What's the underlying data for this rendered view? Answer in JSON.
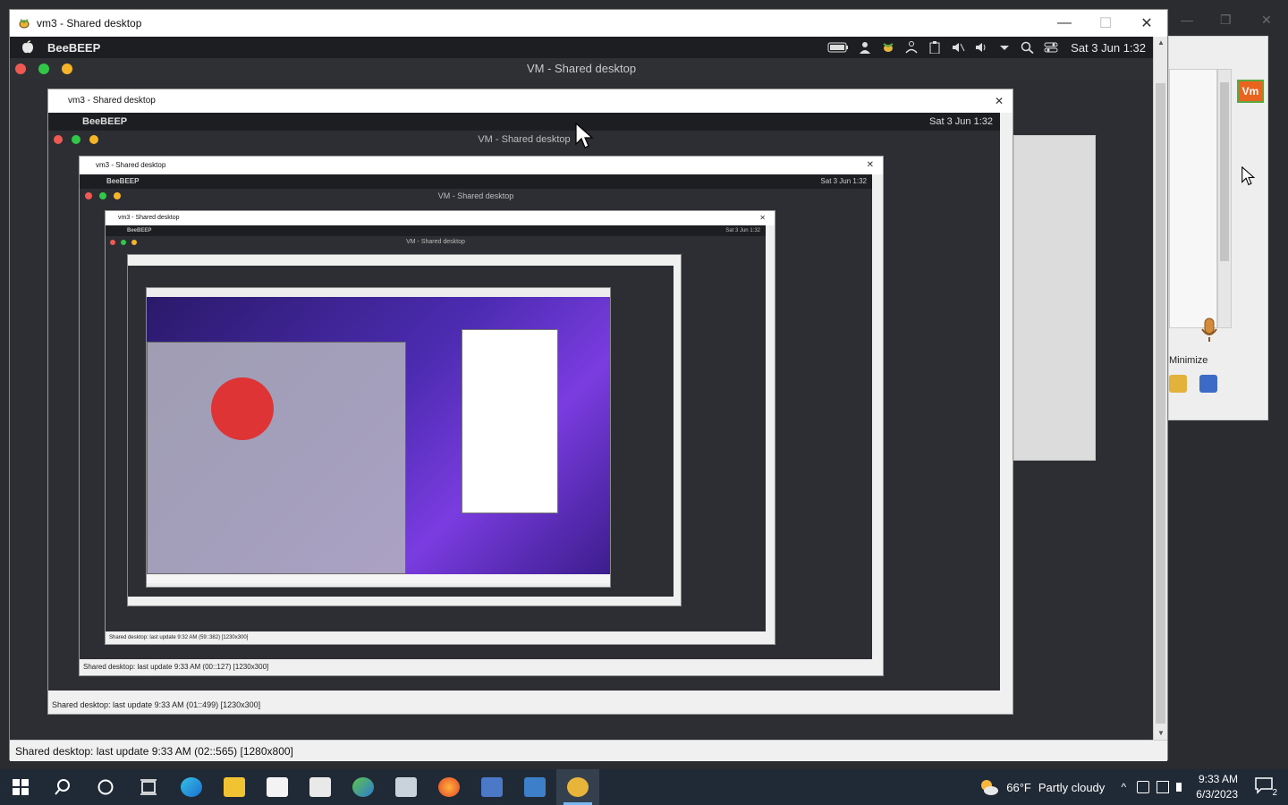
{
  "main_window": {
    "title": "vm3 - Shared desktop",
    "minimize_glyph": "—",
    "maximize_glyph": "☐",
    "close_glyph": "✕"
  },
  "mac_menubar": {
    "app_name": "BeeBEEP",
    "clock": "Sat 3 Jun 1:32"
  },
  "vm_window": {
    "title": "VM - Shared desktop"
  },
  "status_bar": {
    "text": "Shared desktop: last update 9:33 AM (02::565) [1280x800]"
  },
  "nested": [
    {
      "title": "vm3 - Shared desktop",
      "vm_title": "VM - Shared desktop",
      "clock": "Sat 3 Jun 1:32",
      "app_name": "BeeBEEP",
      "status": "Shared desktop: last update 9:33 AM (01::499) [1230x300]"
    },
    {
      "title": "vm3 - Shared desktop",
      "vm_title": "VM - Shared desktop",
      "clock": "Sat 3 Jun 1:32",
      "app_name": "BeeBEEP",
      "status": "Shared desktop: last update 9:33 AM (00::127) [1230x300]"
    },
    {
      "title": "vm3 - Shared desktop",
      "vm_title": "VM - Shared desktop",
      "clock": "Sat 3 Jun 1:32",
      "app_name": "BeeBEEP",
      "status": "Shared desktop: last update 9:32 AM (59::382) [1230x300]"
    }
  ],
  "side_panel": {
    "badge": "Vm",
    "minimize_label": "Minimize"
  },
  "taskbar": {
    "weather_temp": "66°F",
    "weather_desc": "Partly cloudy",
    "time": "9:33 AM",
    "date": "6/3/2023",
    "notifications": "2"
  },
  "colors": {
    "accent": "#79b8f0",
    "traffic_red": "#ee5a52",
    "traffic_green": "#33c748",
    "traffic_yellow": "#f5b529",
    "vm_badge": "#e8641f"
  }
}
